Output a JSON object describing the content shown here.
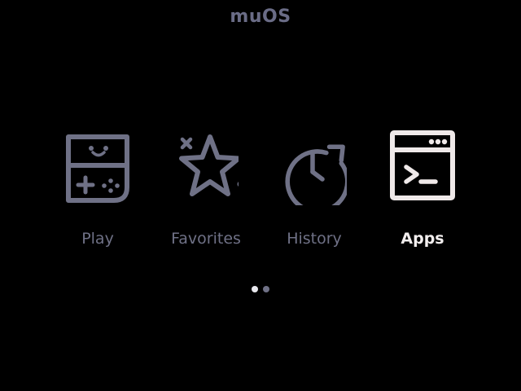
{
  "header": {
    "title": "muOS"
  },
  "menu": {
    "items": [
      {
        "label": "Play",
        "icon": "handheld-console-icon",
        "selected": false
      },
      {
        "label": "Favorites",
        "icon": "star-icon",
        "selected": false
      },
      {
        "label": "History",
        "icon": "clock-history-icon",
        "selected": false
      },
      {
        "label": "Apps",
        "icon": "terminal-window-icon",
        "selected": true
      }
    ]
  },
  "pagination": {
    "current_page": 1,
    "total_pages": 2
  },
  "colors": {
    "background": "#000000",
    "icon_inactive": "#6f7186",
    "icon_selected": "#efe9e9",
    "title": "#6a6c86",
    "dot_active": "#e8e8ee",
    "dot_inactive": "#6f7186"
  }
}
